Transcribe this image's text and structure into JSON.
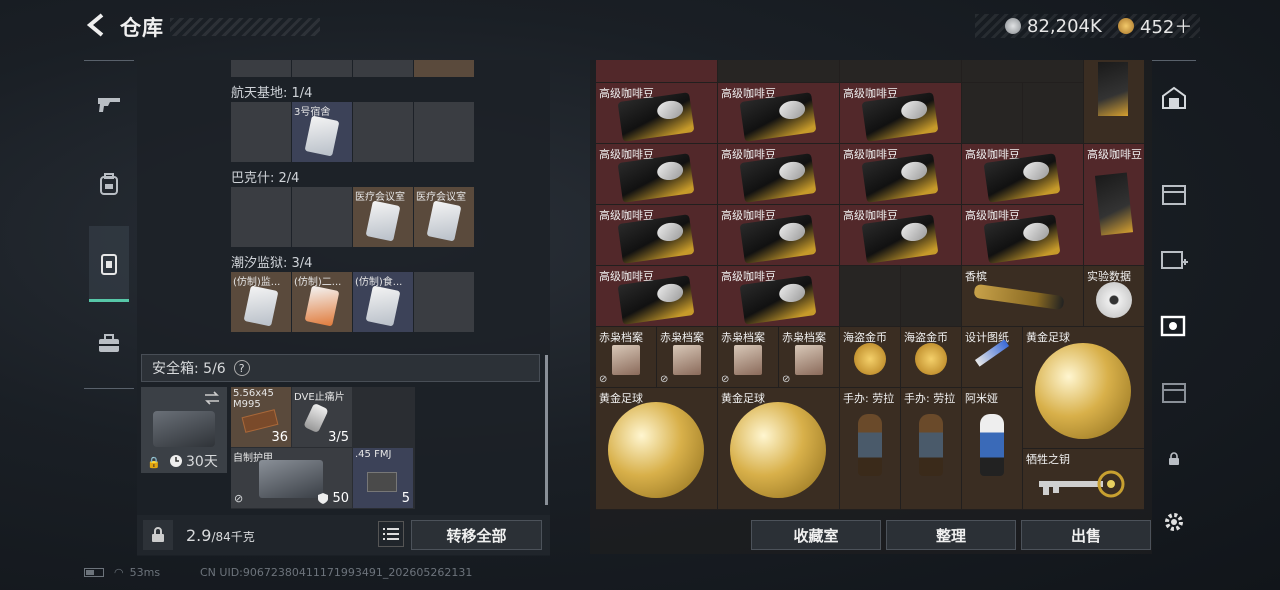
{
  "header": {
    "back_icon": "chevron-left-icon",
    "title": "仓库",
    "currency": [
      {
        "icon": "silver-coin-icon",
        "value": "82,204K",
        "color": "#c0c4c8"
      },
      {
        "icon": "gold-coin-icon",
        "value": "452＋",
        "color": "#d4a045"
      }
    ]
  },
  "left_nav": [
    {
      "icon": "gun-icon"
    },
    {
      "icon": "backpack-icon"
    },
    {
      "icon": "chest-rig-icon",
      "active": true
    },
    {
      "icon": "briefcase-icon"
    }
  ],
  "storage": {
    "sections": [
      {
        "label": "航天基地: 1/4",
        "cells": [
          {
            "label": "",
            "color": "gray"
          },
          {
            "label": "3号宿舍",
            "color": "blue",
            "icon": "keycard-icon"
          },
          {
            "label": "",
            "color": "gray"
          },
          {
            "label": "",
            "color": "gray"
          }
        ]
      },
      {
        "label": "巴克什: 2/4",
        "cells": [
          {
            "label": "",
            "color": "gray"
          },
          {
            "label": "",
            "color": "gray"
          },
          {
            "label": "医疗会议室",
            "color": "brown",
            "icon": "keycard-icon"
          },
          {
            "label": "医疗会议室",
            "color": "brown",
            "icon": "keycard-icon"
          }
        ]
      },
      {
        "label": "潮汐监狱: 3/4",
        "cells": [
          {
            "label": "(仿制)监...",
            "color": "brown",
            "icon": "keycard-icon"
          },
          {
            "label": "(仿制)二...",
            "color": "brown",
            "icon": "keycard-icon"
          },
          {
            "label": "(仿制)食...",
            "color": "blue",
            "icon": "keycard-icon"
          },
          {
            "label": "",
            "color": "gray"
          }
        ]
      }
    ],
    "safebox": {
      "label": "安全箱: 5/6",
      "help": "?",
      "days": "30天",
      "items": [
        {
          "label": "5.56x45 M995",
          "count": "36"
        },
        {
          "label": "DVE止痛片",
          "count": "3/5"
        },
        {
          "label": "自制护甲",
          "count": "50"
        },
        {
          "label": ".45 FMJ",
          "count": "5"
        }
      ]
    },
    "weight": "2.9",
    "weight_unit": "/84千克",
    "transfer_all": "转移全部"
  },
  "stash": {
    "coffee_label": "高级咖啡豆",
    "perfume": "香槟",
    "data_disc": "实验数据",
    "red_owl": "赤枭档案",
    "pirate_coin": "海盗金币",
    "blueprint": "设计图纸",
    "gold_ball": "黄金足球",
    "figure_lara": "手办: 劳拉",
    "figure_amiya": "阿米娅",
    "key": "牺牲之钥"
  },
  "bottom_buttons": {
    "collection": "收藏室",
    "organize": "整理",
    "sell": "出售"
  },
  "footer": {
    "ping": "53ms",
    "uid": "CN UID:90672380411171993491_202605262131"
  }
}
